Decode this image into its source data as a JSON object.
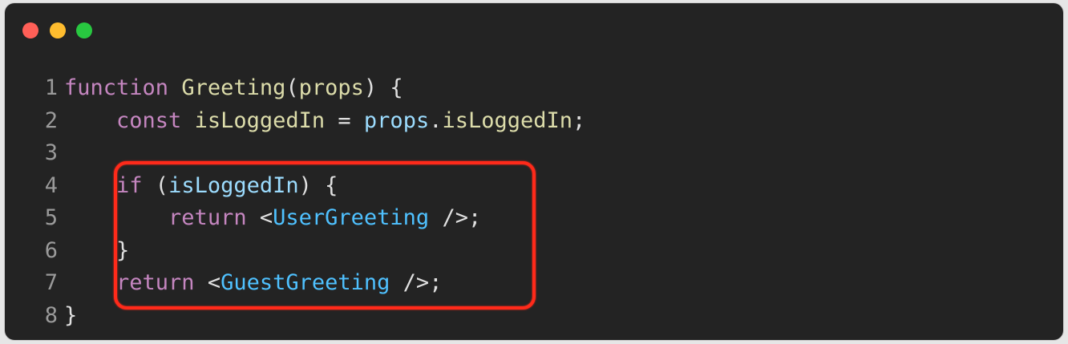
{
  "window": {
    "buttons": {
      "close_color": "#ff5f57",
      "minimize_color": "#febc2e",
      "maximize_color": "#28c840"
    }
  },
  "code": {
    "lines": [
      {
        "number": "1",
        "tokens": [
          {
            "t": "function",
            "c": "kw"
          },
          {
            "t": " ",
            "c": "punc"
          },
          {
            "t": "Greeting",
            "c": "fn"
          },
          {
            "t": "(",
            "c": "punc"
          },
          {
            "t": "props",
            "c": "fn"
          },
          {
            "t": ") {",
            "c": "punc"
          }
        ]
      },
      {
        "number": "2",
        "tokens": [
          {
            "t": "    ",
            "c": "punc"
          },
          {
            "t": "const",
            "c": "kw"
          },
          {
            "t": " ",
            "c": "punc"
          },
          {
            "t": "isLoggedIn",
            "c": "fn"
          },
          {
            "t": " = ",
            "c": "punc"
          },
          {
            "t": "props",
            "c": "var"
          },
          {
            "t": ".",
            "c": "punc"
          },
          {
            "t": "isLoggedIn",
            "c": "fn"
          },
          {
            "t": ";",
            "c": "punc"
          }
        ]
      },
      {
        "number": "3",
        "tokens": []
      },
      {
        "number": "4",
        "tokens": [
          {
            "t": "    ",
            "c": "punc"
          },
          {
            "t": "if",
            "c": "kw"
          },
          {
            "t": " (",
            "c": "punc"
          },
          {
            "t": "isLoggedIn",
            "c": "var"
          },
          {
            "t": ") {",
            "c": "punc"
          }
        ]
      },
      {
        "number": "5",
        "tokens": [
          {
            "t": "        ",
            "c": "punc"
          },
          {
            "t": "return",
            "c": "kw"
          },
          {
            "t": " <",
            "c": "punc"
          },
          {
            "t": "UserGreeting",
            "c": "comp"
          },
          {
            "t": " />;",
            "c": "punc"
          }
        ]
      },
      {
        "number": "6",
        "tokens": [
          {
            "t": "    }",
            "c": "punc"
          }
        ]
      },
      {
        "number": "7",
        "tokens": [
          {
            "t": "    ",
            "c": "punc"
          },
          {
            "t": "return",
            "c": "kw"
          },
          {
            "t": " <",
            "c": "punc"
          },
          {
            "t": "GuestGreeting",
            "c": "comp"
          },
          {
            "t": " />;",
            "c": "punc"
          }
        ]
      },
      {
        "number": "8",
        "tokens": [
          {
            "t": "}",
            "c": "punc"
          }
        ]
      }
    ]
  },
  "annotation": {
    "color": "#ff2a1a"
  }
}
